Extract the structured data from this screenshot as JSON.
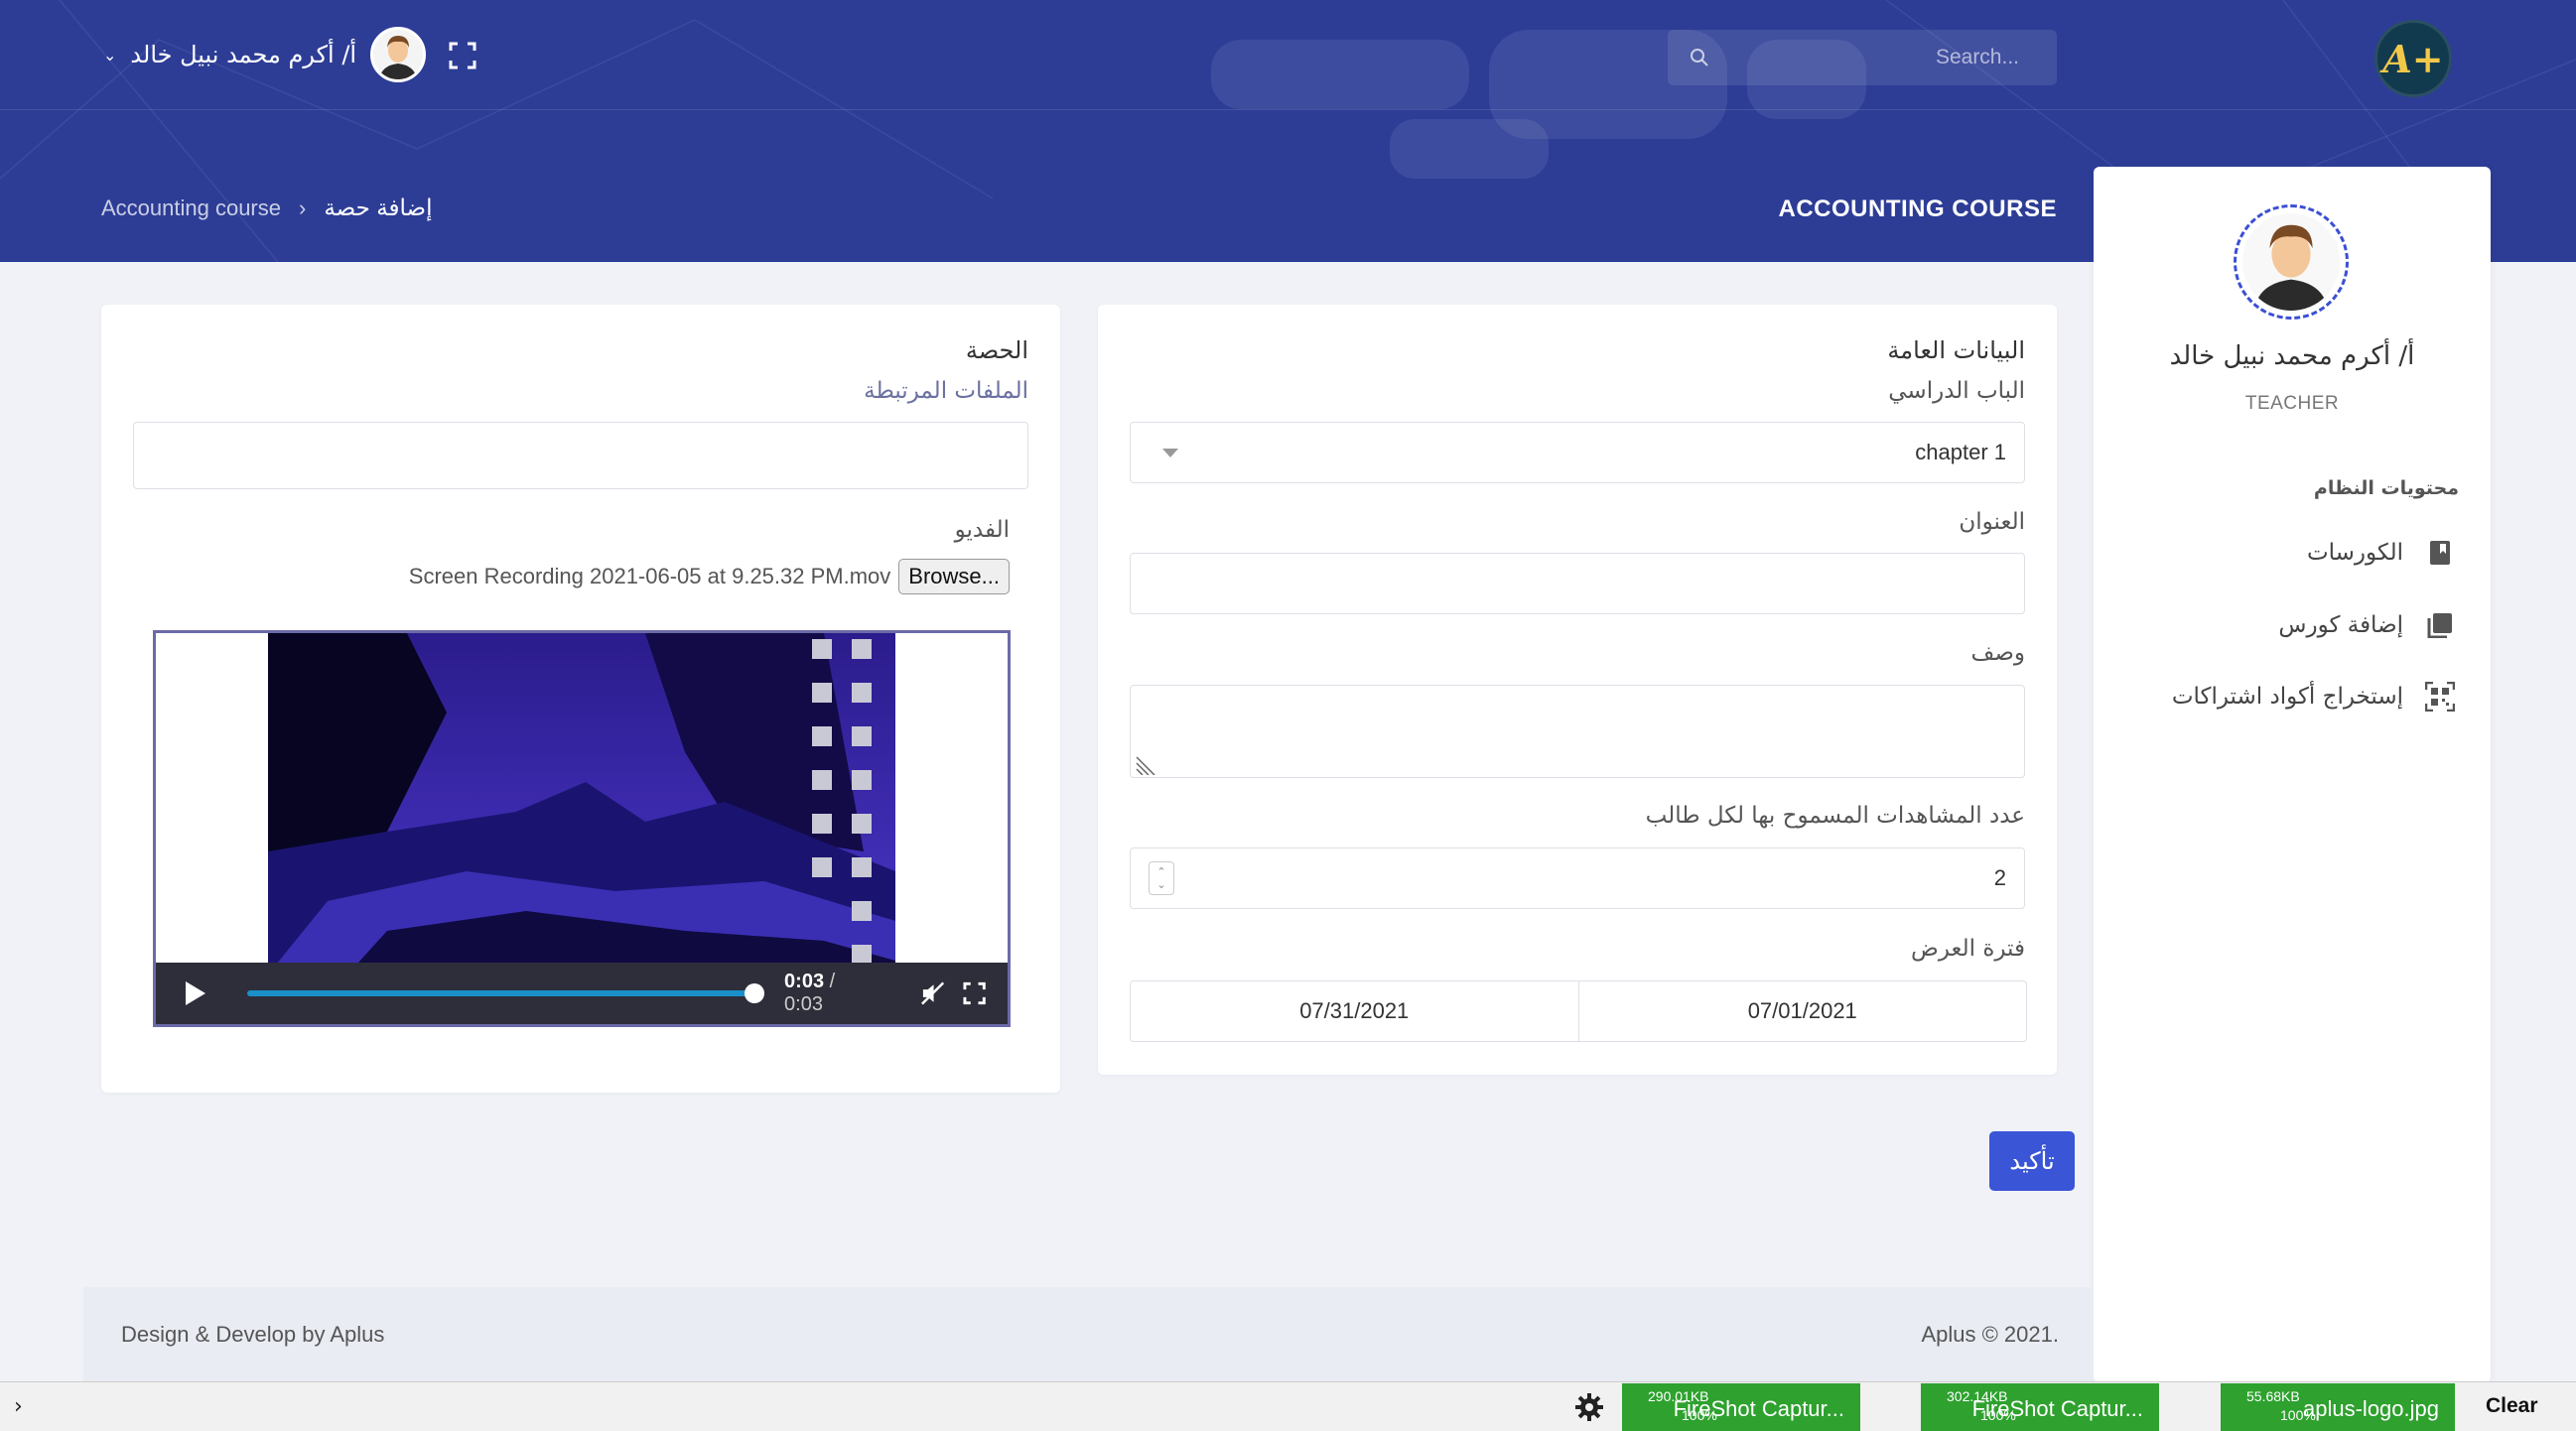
{
  "header": {
    "search_placeholder": "Search...",
    "user_name": "أ/ أكرم محمد نبيل خالد",
    "page_title": "ACCOUNTING COURSE",
    "breadcrumb": {
      "parent": "Accounting course",
      "current": "إضافة حصة"
    }
  },
  "sidebar": {
    "name": "أ/ أكرم محمد نبيل خالد",
    "role": "TEACHER",
    "heading": "محتويات النظام",
    "items": [
      {
        "label": "الكورسات",
        "icon": "bookmark-book-icon"
      },
      {
        "label": "إضافة كورس",
        "icon": "books-icon"
      },
      {
        "label": "إستخراج أكواد اشتراكات",
        "icon": "qrcode-icon"
      }
    ]
  },
  "general": {
    "title": "البيانات العامة",
    "chapter_label": "الباب الدراسي",
    "chapter_value": "chapter 1",
    "title_label": "العنوان",
    "title_value": "",
    "description_label": "وصف",
    "views_label": "عدد المشاهدات المسموح بها لكل طالب",
    "views_value": "2",
    "period_label": "فترة العرض",
    "date_from": "07/01/2021",
    "date_to": "07/31/2021"
  },
  "lesson": {
    "title": "الحصة",
    "files_label": "الملفات المرتبطة",
    "video_label": "الفديو",
    "browse_label": "Browse...",
    "file_name": "Screen Recording 2021-06-05 at 9.25.32 PM.mov",
    "current_time": "0:03",
    "total_time": "/ 0:03",
    "progress": 1.0
  },
  "confirm_label": "تأكيد",
  "footer": {
    "left": "Design & Develop by Aplus",
    "right": "Aplus © 2021."
  },
  "downloads": [
    {
      "name": "FireShot Captur...",
      "size": "290.01KB",
      "pct": "100%"
    },
    {
      "name": "FireShot Captur...",
      "size": "302.14KB",
      "pct": "100%"
    },
    {
      "name": "aplus-logo.jpg",
      "size": "55.68KB",
      "pct": "100%"
    }
  ],
  "shelf_clear": "Clear",
  "colors": {
    "header": "#2d3d96",
    "accent": "#3a55d6",
    "download": "#2ea12e"
  }
}
